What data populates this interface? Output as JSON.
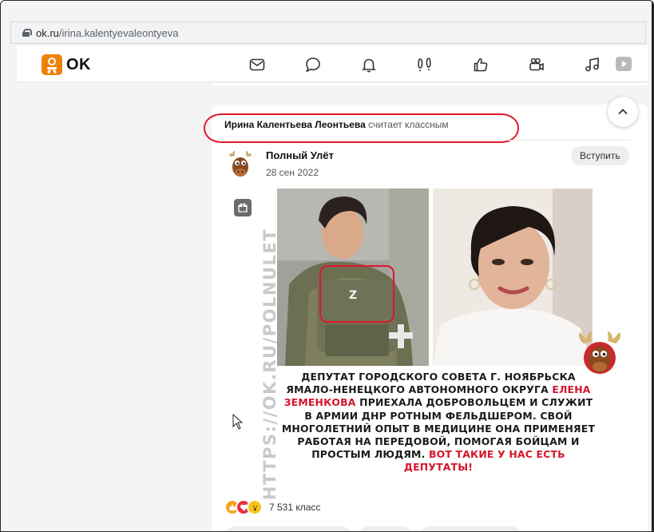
{
  "browser": {
    "url_host": "ok.ru",
    "url_path": "/irina.kalentyevaleontyeva",
    "lock_icon": "lock-icon"
  },
  "nav": {
    "logo_text": "OK",
    "brand_color": "#ee8208",
    "icons": [
      "envelope-icon",
      "chat-bubble-icon",
      "bell-icon",
      "guests-footprints-icon",
      "thumbs-up-icon",
      "video-camera-icon",
      "music-note-icon",
      "play-icon"
    ]
  },
  "post": {
    "activity_user": "Ирина Калентьева Леонтьева",
    "activity_text": " считает классным",
    "group_name": "Полный Улёт",
    "date": "28 сен 2022",
    "join_label": "Вступить",
    "image": {
      "watermark": "HTTPS://OK.RU/POLNULET",
      "z_mark": "Z",
      "caption_parts": [
        {
          "text": "ДЕПУТАТ ГОРОДСКОГО СОВЕТА Г. НОЯБРЬСКА ЯМАЛО-НЕНЕЦКОГО АВТОНОМНОГО ОКРУГА ",
          "red": false
        },
        {
          "text": "ЕЛЕНА ЗЕМЕНКОВА",
          "red": true
        },
        {
          "text": " ПРИЕХАЛА ДОБРОВОЛЬЦЕМ И СЛУЖИТ В АРМИИ ДНР РОТНЫМ ФЕЛЬДШЕРОМ. СВОЙ МНОГОЛЕТНИЙ ОПЫТ В МЕДИЦИНЕ ОНА ПРИМЕНЯЕТ РАБОТАЯ НА ПЕРЕДОВОЙ, ПОМОГАЯ БОЙЦАМ И ПРОСТЫМ ЛЮДЯМ. ",
          "red": false
        },
        {
          "text": "ВОТ ТАКИЕ У НАС ЕСТЬ ДЕПУТАТЫ!",
          "red": true
        }
      ]
    },
    "reactions_count": "7 531 класс",
    "highlight_color": "#e0162b"
  }
}
